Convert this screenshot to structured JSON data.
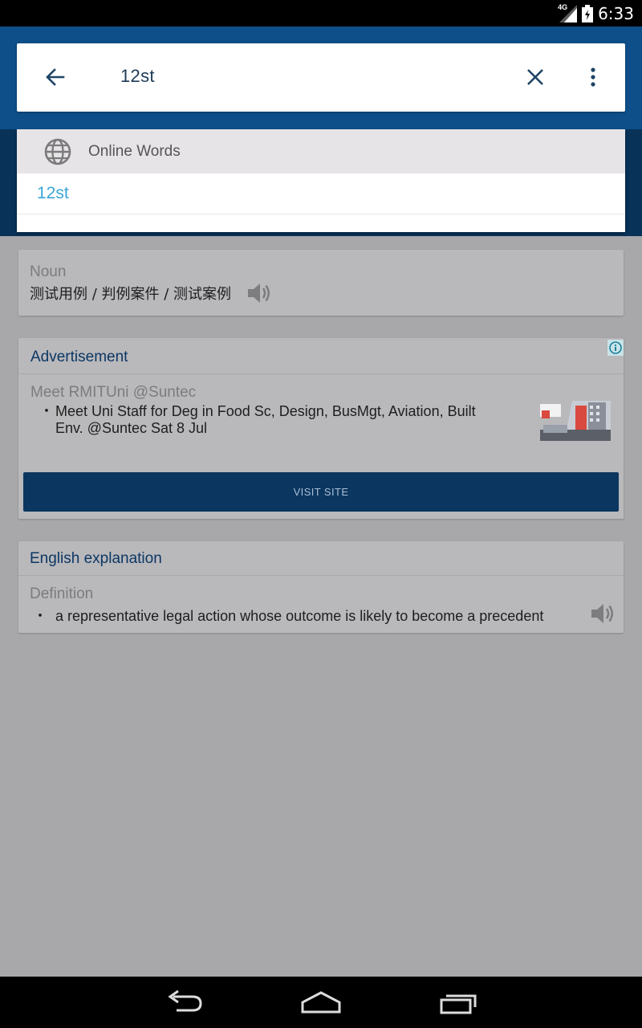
{
  "status_bar": {
    "network": "4G",
    "time": "6:33"
  },
  "search": {
    "value": "12st"
  },
  "suggestions": {
    "header": "Online Words",
    "items": [
      "12st"
    ]
  },
  "noun_card": {
    "pos": "Noun",
    "translation": "测试用例 / 判例案件 / 测试案例"
  },
  "ad_card": {
    "title": "Advertisement",
    "headline": "Meet RMITUni @Suntec",
    "bullet": "Meet Uni Staff for Deg in Food Sc, Design, BusMgt, Aviation, Built Env. @Suntec Sat 8 Jul",
    "button": "VISIT SITE"
  },
  "english_card": {
    "title": "English explanation",
    "label": "Definition",
    "definition": "a representative legal action whose outcome is likely to become a precedent"
  },
  "bullet_char": "・",
  "colors": {
    "header": "#0e4f89",
    "header_dark": "#093258",
    "accent_link": "#3aa6d6",
    "button": "#0b365f"
  }
}
